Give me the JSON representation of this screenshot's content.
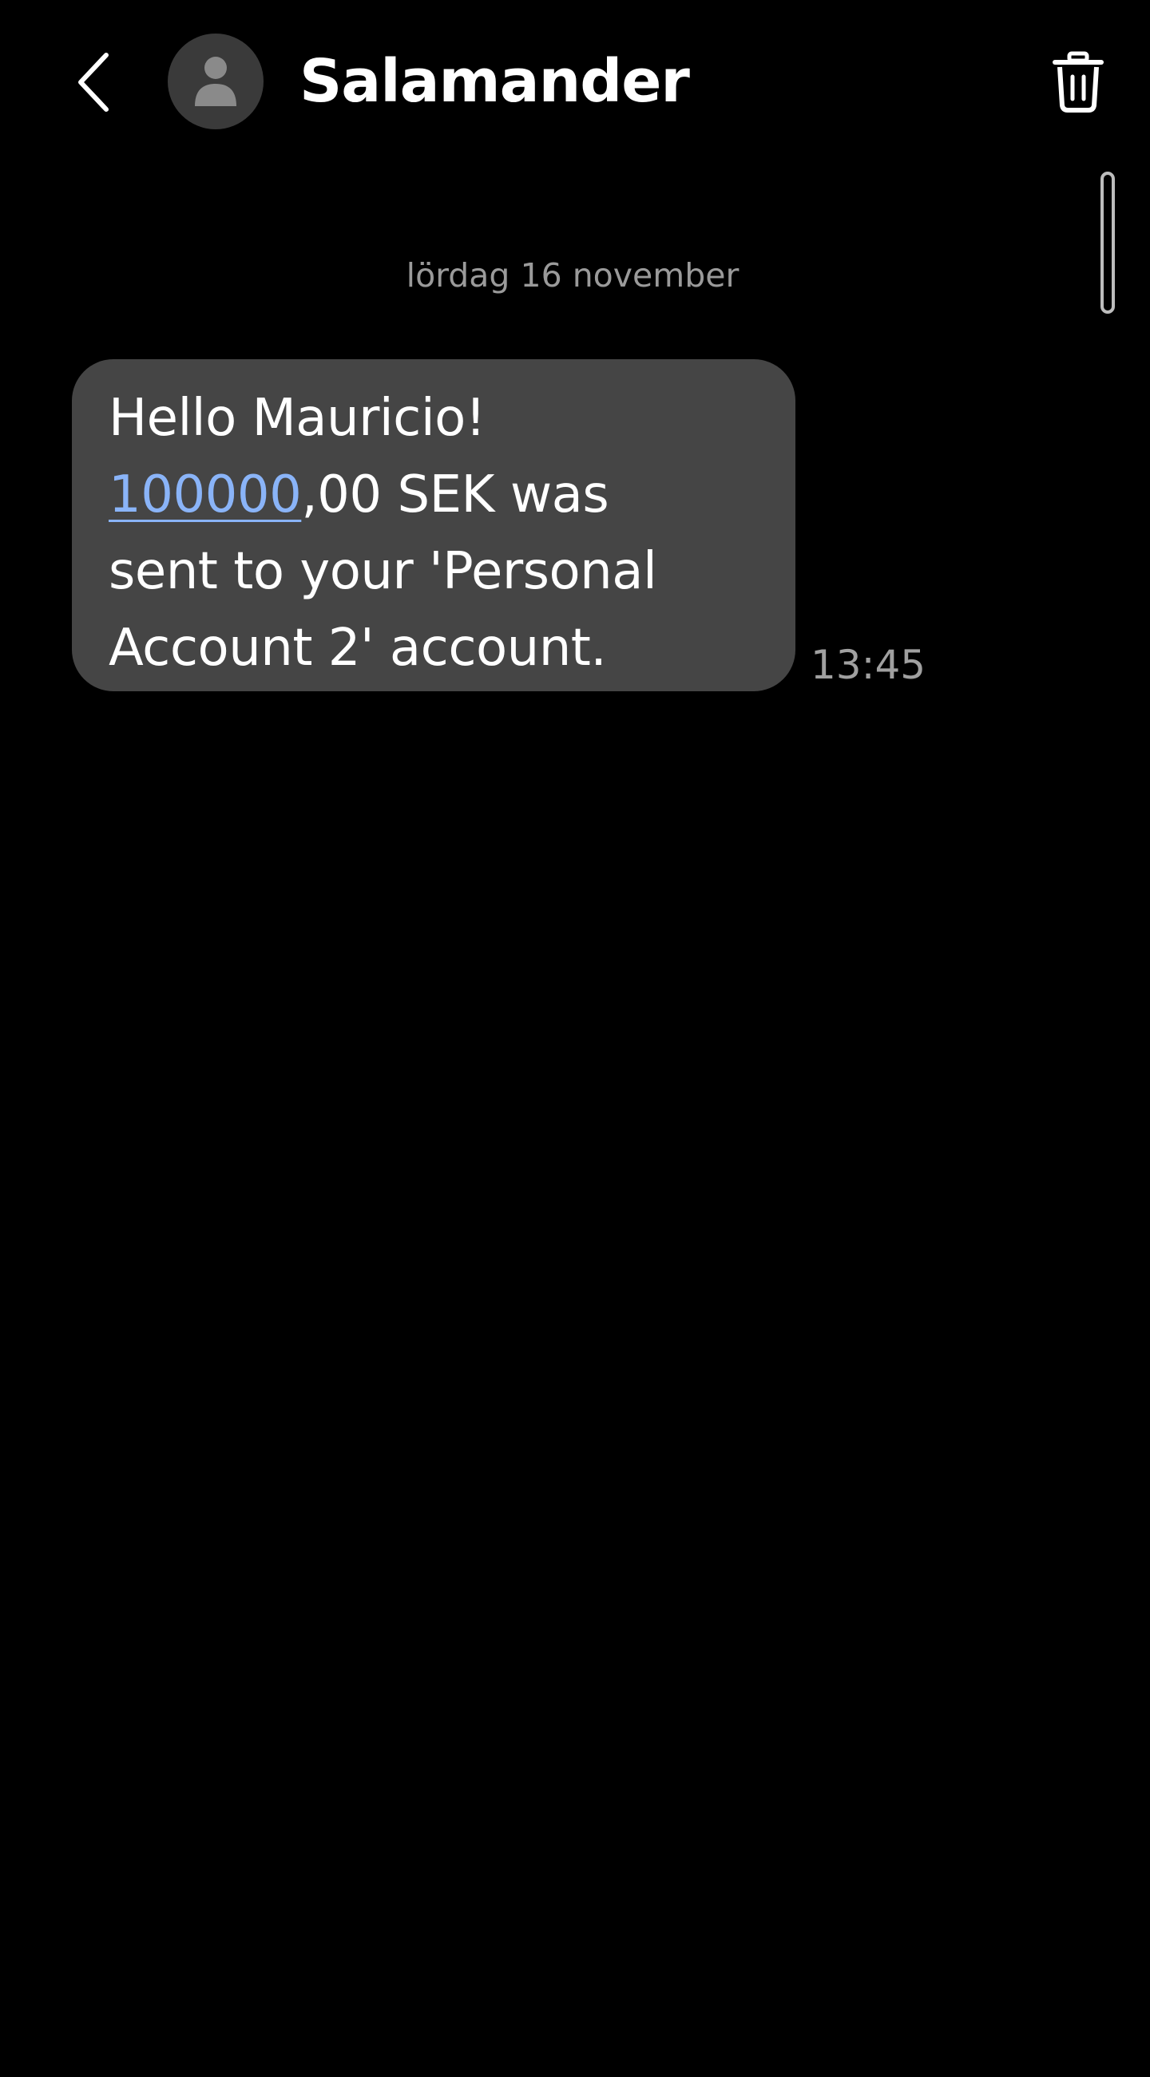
{
  "header": {
    "contact_name": "Salamander",
    "back_icon": "chevron-left-icon",
    "avatar_icon": "person-icon",
    "delete_icon": "trash-icon"
  },
  "conversation": {
    "date_separator": "lördag 16 november",
    "messages": [
      {
        "lines": [
          {
            "parts": [
              {
                "text": "Hello Mauricio!",
                "link": false
              }
            ]
          },
          {
            "parts": [
              {
                "text": "100000",
                "link": true
              },
              {
                "text": ",00 SEK was",
                "link": false
              }
            ]
          },
          {
            "parts": [
              {
                "text": "sent to your 'Personal",
                "link": false
              }
            ]
          },
          {
            "parts": [
              {
                "text": "Account 2' account.",
                "link": false
              }
            ]
          }
        ],
        "time": "13:45"
      }
    ]
  },
  "colors": {
    "background": "#000000",
    "bubble": "#454545",
    "link": "#8ab4f8",
    "secondary_text": "#9a9a9a",
    "avatar_bg": "#3a3a3a"
  }
}
